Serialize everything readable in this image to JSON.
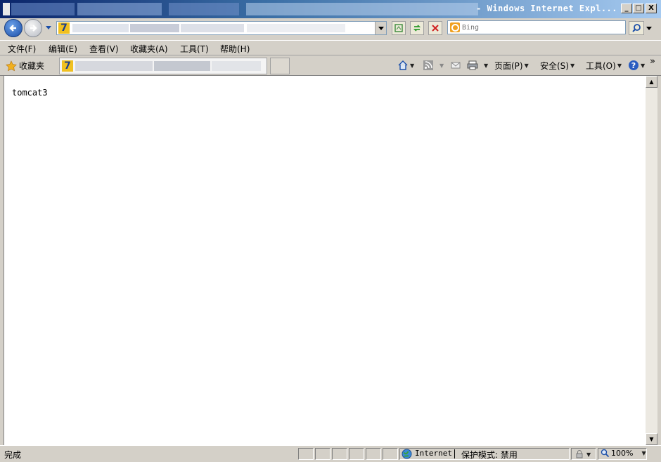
{
  "window": {
    "title": "- Windows Internet Expl...",
    "buttons": {
      "minimize": "_",
      "restore": "□",
      "close": "X"
    }
  },
  "address_bar": {
    "site_icon": "7"
  },
  "search": {
    "placeholder": "Bing"
  },
  "menu": {
    "items": [
      "文件(F)",
      "编辑(E)",
      "查看(V)",
      "收藏夹(A)",
      "工具(T)",
      "帮助(H)"
    ]
  },
  "favorites_bar": {
    "favorites_label": "收藏夹",
    "tab_icon": "7",
    "overflow": "»"
  },
  "command_bar": {
    "page_label": "页面(P)",
    "safety_label": "安全(S)",
    "tools_label": "工具(O)"
  },
  "content": {
    "text": "tomcat3"
  },
  "status": {
    "text": "完成",
    "zone": "Internet",
    "protected_mode": "保护模式: 禁用",
    "zoom": "100%"
  },
  "icons": [
    "back-arrow-icon",
    "forward-arrow-icon",
    "dropdown-icon",
    "compatibility-icon",
    "refresh-icon",
    "stop-icon",
    "bing-icon",
    "search-icon",
    "favorites-star-icon",
    "home-icon",
    "rss-icon",
    "mail-icon",
    "print-icon",
    "help-icon",
    "globe-icon",
    "lock-icon",
    "zoom-icon"
  ],
  "colors": {
    "title_start": "#0a246a",
    "title_end": "#a6caf0",
    "chrome": "#d4d0c8",
    "accent_orange": "#f0a020"
  }
}
